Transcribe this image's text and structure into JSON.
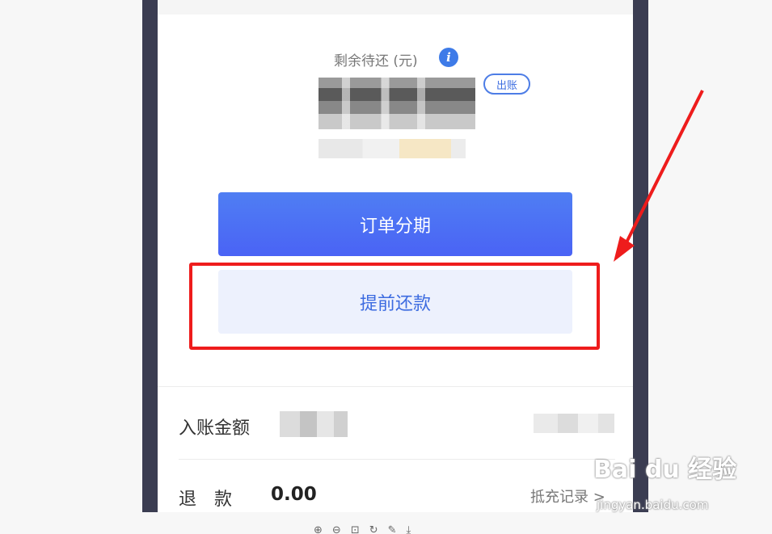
{
  "card": {
    "remaining_label": "剩余待还 (元)",
    "info_icon_glyph": "i",
    "status_badge": "出账"
  },
  "actions": {
    "installment_label": "订单分期",
    "prepay_label": "提前还款"
  },
  "details": {
    "posted_amount_label": "入账金额",
    "refund_label": "退　款",
    "refund_value": "0.00",
    "record_link": "抵充记录 >"
  },
  "watermark": {
    "main": "Bai du 经验",
    "sub": "jingyan.baidu.com"
  },
  "toolbar": [
    "⊕",
    "⊖",
    "⊡",
    "↻",
    "✎",
    "⤓"
  ],
  "colors": {
    "frame": "#3b3d52",
    "primary_button": "#4a63f5",
    "secondary_button": "#edf1fd",
    "highlight": "#ee1c1c"
  }
}
